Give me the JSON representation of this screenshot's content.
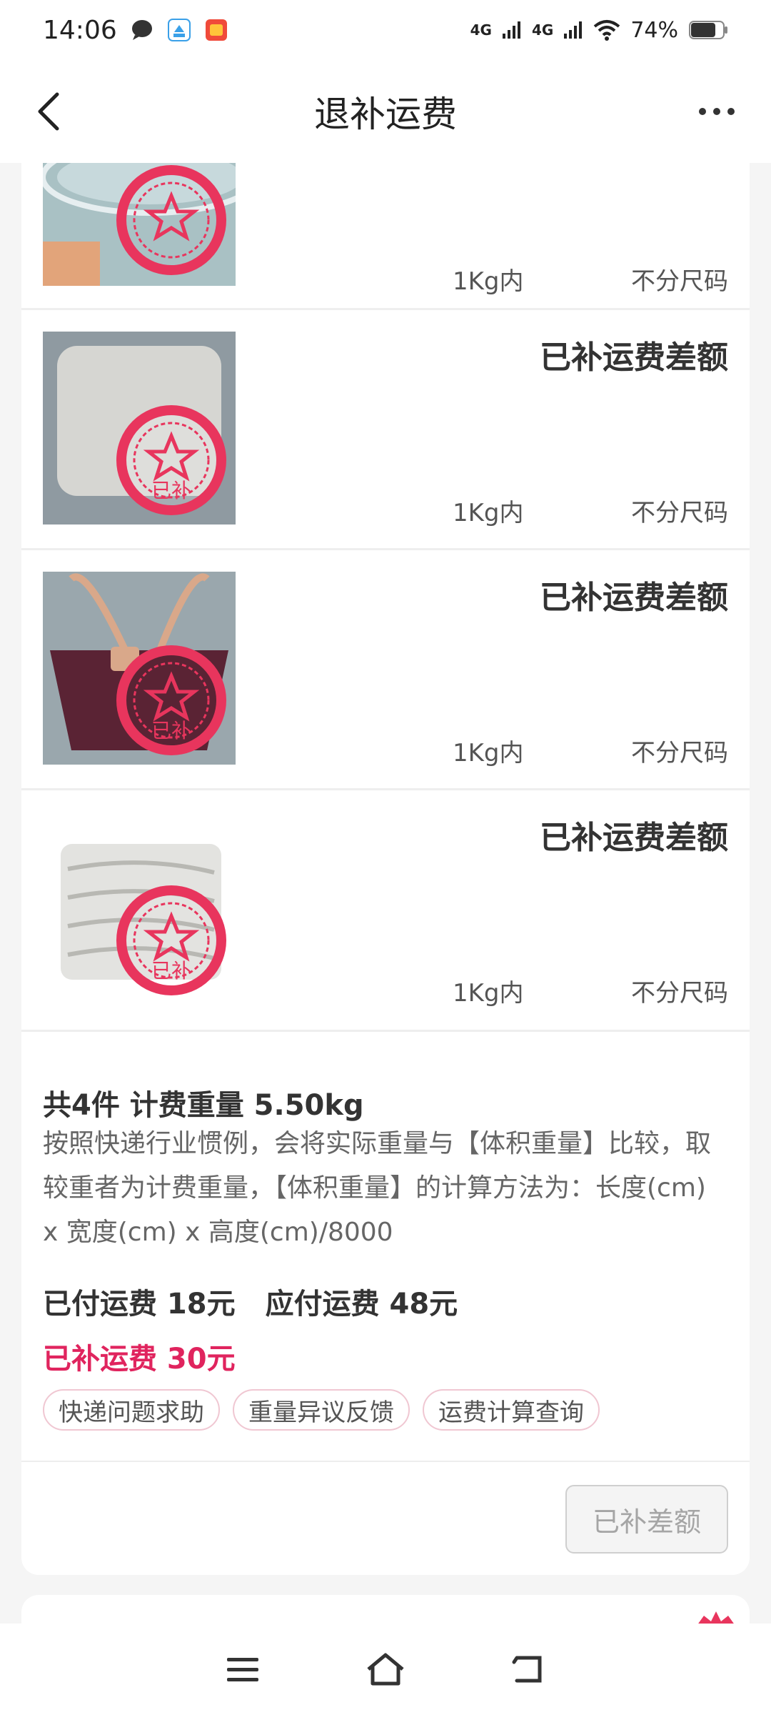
{
  "status_bar": {
    "time": "14:06",
    "battery": "74%",
    "network1": "4G",
    "network2": "4G",
    "icons": [
      "message-icon",
      "app-icon",
      "app-icon-2",
      "signal-icon",
      "wifi-icon",
      "battery-icon"
    ]
  },
  "nav": {
    "title": "退补运费",
    "back_icon": "chevron-left-icon",
    "more_icon": "more-icon"
  },
  "items": [
    {
      "status": "",
      "weight": "1Kg内",
      "size": "不分尺码"
    },
    {
      "status": "已补运费差额",
      "weight": "1Kg内",
      "size": "不分尺码"
    },
    {
      "status": "已补运费差额",
      "weight": "1Kg内",
      "size": "不分尺码"
    },
    {
      "status": "已补运费差额",
      "weight": "1Kg内",
      "size": "不分尺码"
    }
  ],
  "stamp_text": "已补",
  "summary": {
    "title": "共4件 计费重量 5.50kg",
    "description": "按照快递行业惯例，会将实际重量与【体积重量】比较，取较重者为计费重量，【体积重量】的计算方法为：长度(cm) x 宽度(cm) x 高度(cm)/8000",
    "paid_fee": "已付运费 18元",
    "due_fee": "应付运费 48元",
    "extra_fee": "已补运费 30元"
  },
  "chips": [
    "快递问题求助",
    "重量异议反馈",
    "运费计算查询"
  ],
  "action_button": "已补差额",
  "bottom_nav": {
    "menu_icon": "menu-icon",
    "home_icon": "home-icon",
    "back_icon": "back-icon"
  },
  "colors": {
    "accent": "#e0245e",
    "stamp": "#e8355d"
  }
}
